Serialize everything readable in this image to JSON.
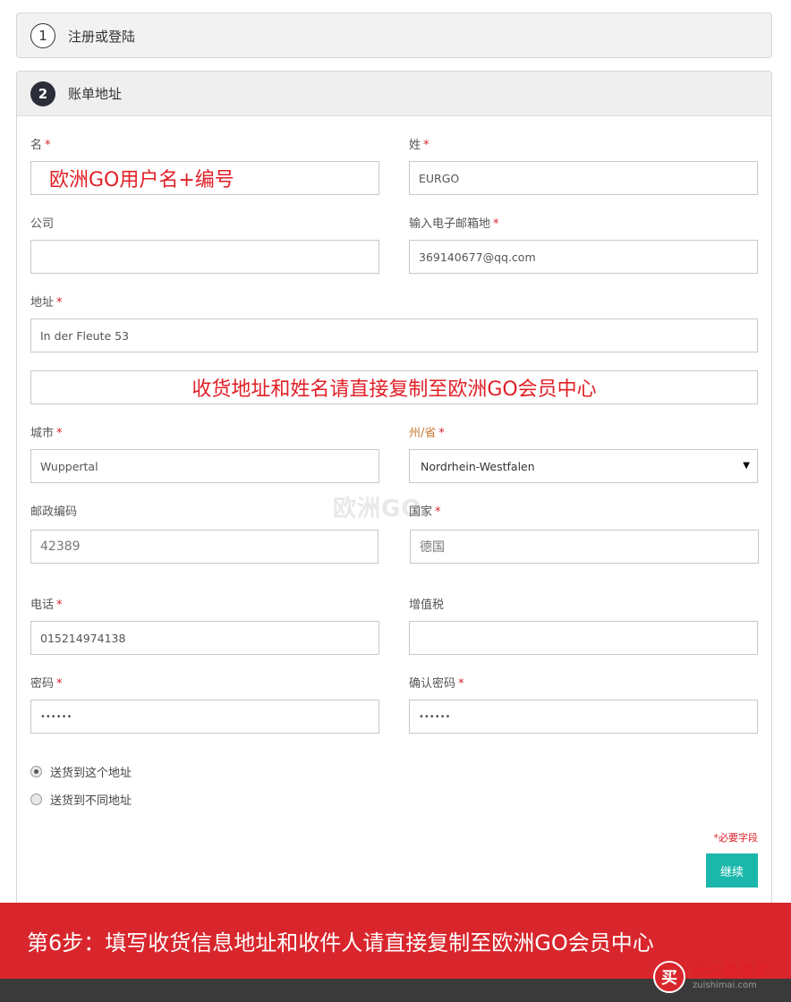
{
  "steps": {
    "step1": {
      "num": "1",
      "title": "注册或登陆"
    },
    "step2": {
      "num": "2",
      "title": "账单地址"
    }
  },
  "form": {
    "first_name": {
      "label": "名",
      "value": "欧洲GO用户名+编号"
    },
    "last_name": {
      "label": "姓",
      "value": "EURGO"
    },
    "company": {
      "label": "公司",
      "value": ""
    },
    "email": {
      "label": "输入电子邮箱地",
      "value": "369140677@qq.com"
    },
    "address": {
      "label": "地址",
      "value": "In der Fleute 53"
    },
    "notice": "收货地址和姓名请直接复制至欧洲GO会员中心",
    "city": {
      "label": "城市",
      "value": "Wuppertal"
    },
    "state": {
      "label": "州/省",
      "value": "Nordrhein-Westfalen"
    },
    "postcode": {
      "label": "邮政编码",
      "value": "42389"
    },
    "country": {
      "label": "国家",
      "value": "德国"
    },
    "phone": {
      "label": "电话",
      "value": "015214974138"
    },
    "vat": {
      "label": "增值税",
      "value": ""
    },
    "password": {
      "label": "密码",
      "value": "••••••"
    },
    "confirm_password": {
      "label": "确认密码",
      "value": "••••••"
    },
    "required_star": "*"
  },
  "shipping": {
    "same_address": "送货到这个地址",
    "different_address": "送货到不同地址",
    "selected": "same_address"
  },
  "required_note": "*必要字段",
  "continue_label": "继续",
  "watermark": "欧洲GO",
  "banner": "第6步：填写收货信息地址和收件人请直接复制至欧洲GO会员中心",
  "brand": {
    "cn": "什么最值买",
    "url": "zuishimai.com",
    "logo_char": "买"
  },
  "colors": {
    "accent": "#1bb7ab",
    "required": "#d8202a",
    "banner": "#d8262c"
  }
}
